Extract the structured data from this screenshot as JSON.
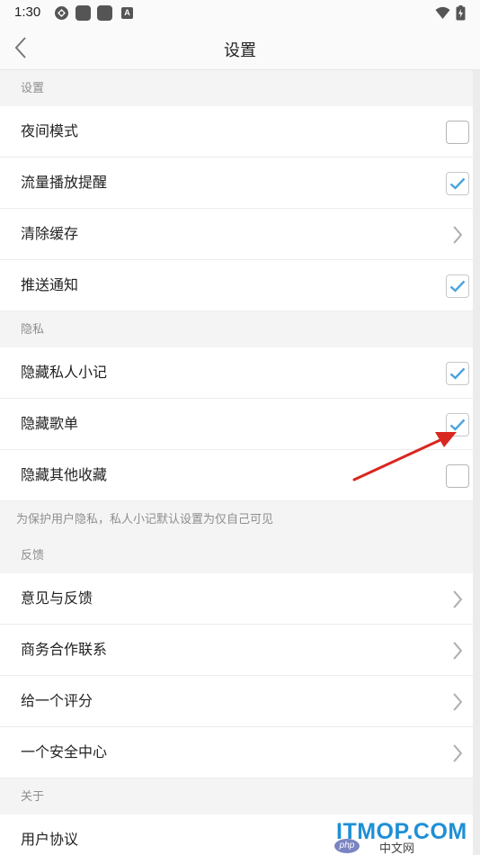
{
  "status_bar": {
    "time": "1:30",
    "notification_a_label": "A",
    "icons": [
      "sync-icon",
      "app-icon",
      "app-icon",
      "a-icon",
      "wifi-icon",
      "battery-icon"
    ]
  },
  "header": {
    "title": "设置",
    "back_icon": "chevron-left-icon"
  },
  "sections": {
    "settings": {
      "header": "设置",
      "items": [
        {
          "label": "夜间模式",
          "control": "checkbox",
          "checked": false
        },
        {
          "label": "流量播放提醒",
          "control": "checkbox",
          "checked": true
        },
        {
          "label": "清除缓存",
          "control": "chevron"
        },
        {
          "label": "推送通知",
          "control": "checkbox",
          "checked": true
        }
      ]
    },
    "privacy": {
      "header": "隐私",
      "items": [
        {
          "label": "隐藏私人小记",
          "control": "checkbox",
          "checked": true
        },
        {
          "label": "隐藏歌单",
          "control": "checkbox",
          "checked": true
        },
        {
          "label": "隐藏其他收藏",
          "control": "checkbox",
          "checked": false
        }
      ],
      "note": "为保护用户隐私，私人小记默认设置为仅自己可见"
    },
    "feedback": {
      "header": "反馈",
      "items": [
        {
          "label": "意见与反馈",
          "control": "chevron"
        },
        {
          "label": "商务合作联系",
          "control": "chevron"
        },
        {
          "label": "给一个评分",
          "control": "chevron"
        },
        {
          "label": "一个安全中心",
          "control": "chevron"
        }
      ]
    },
    "about": {
      "header": "关于",
      "items": [
        {
          "label": "用户协议"
        }
      ]
    }
  },
  "colors": {
    "check": "#4aa3df",
    "annotation_arrow": "#d9271f",
    "watermark": "#1e8fd6"
  },
  "watermark": {
    "text": "ITMOP.COM",
    "badge": "php",
    "sub": "中文网"
  }
}
